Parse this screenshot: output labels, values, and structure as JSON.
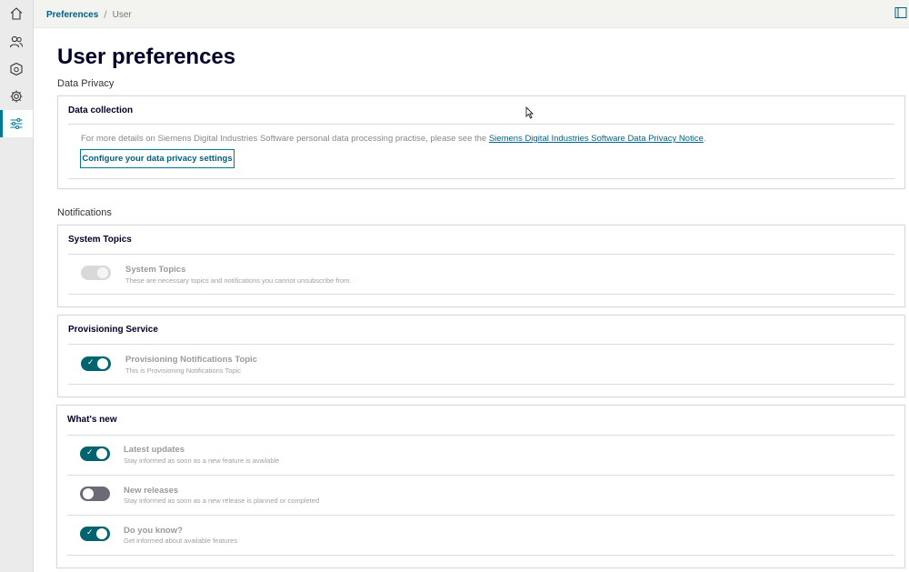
{
  "breadcrumb": {
    "parent": "Preferences",
    "separator": "/",
    "current": "User"
  },
  "page": {
    "title": "User preferences"
  },
  "privacy": {
    "section_label": "Data Privacy",
    "card_title": "Data collection",
    "text": "For more details on Siemens Digital Industries Software personal data processing practise, please see the",
    "link": "Siemens Digital Industries Software Data Privacy Notice",
    "link_suffix": ".",
    "button_label": "Configure your data privacy settings"
  },
  "notifications": {
    "section_label": "Notifications",
    "system_topics": {
      "title": "System Topics",
      "item_title": "System Topics",
      "item_desc": "These are necessary topics and notifications you cannot unsubscribe from.",
      "enabled": true,
      "disabled": true
    },
    "provisioning": {
      "title": "Provisioning Service",
      "item_title": "Provisioning Notifications Topic",
      "item_desc": "This is Provisioning Notifications Topic",
      "enabled": true
    },
    "whats_new": {
      "title": "What's new",
      "items": [
        {
          "title": "Latest updates",
          "desc": "Stay informed as soon as a new feature is available",
          "enabled": true
        },
        {
          "title": "New releases",
          "desc": "Stay informed as soon as a new release is planned or completed",
          "enabled": false
        },
        {
          "title": "Do you know?",
          "desc": "Get informed about available features",
          "enabled": true
        }
      ]
    }
  },
  "sidebar": {
    "items": [
      {
        "icon": "home-icon"
      },
      {
        "icon": "users-icon"
      },
      {
        "icon": "package-settings-icon"
      },
      {
        "icon": "gear-icon"
      },
      {
        "icon": "sliders-icon",
        "active": true
      }
    ]
  },
  "colors": {
    "accent": "#007993",
    "toggle_on": "#00646e",
    "toggle_off": "#6b6b78",
    "title": "#000028"
  }
}
